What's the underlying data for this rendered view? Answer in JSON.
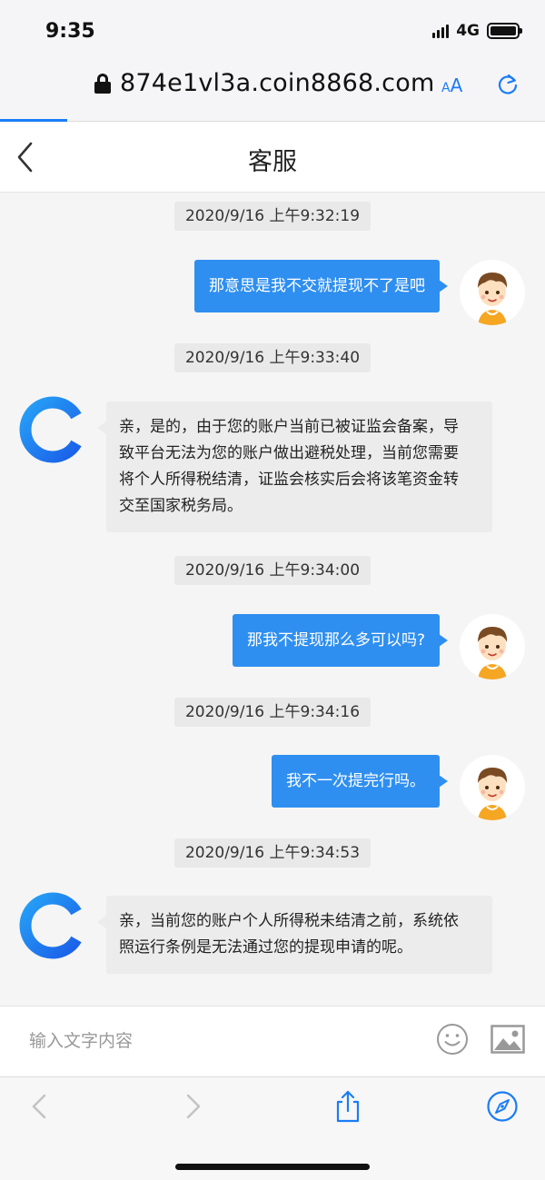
{
  "status_bar": {
    "time": "9:35",
    "network": "4G"
  },
  "browser": {
    "url": "874e1vl3a.coin8868.com",
    "text_size_label_big": "A",
    "text_size_label_small": "A",
    "accent_color": "#1a7cf5"
  },
  "header": {
    "title": "客服"
  },
  "messages": [
    {
      "type": "timestamp",
      "text": "2020/9/16 上午9:32:19"
    },
    {
      "type": "outgoing",
      "text": "那意思是我不交就提现不了是吧"
    },
    {
      "type": "timestamp",
      "text": "2020/9/16 上午9:33:40"
    },
    {
      "type": "incoming",
      "lines": [
        "亲，是的，由于您的账户当前已被证监会备案，导",
        "致平台无法为您的账户做出避税处理，当前您需要",
        "将个人所得税结清，证监会核实后会将该笔资金转",
        "交至国家税务局。"
      ]
    },
    {
      "type": "timestamp",
      "text": "2020/9/16 上午9:34:00"
    },
    {
      "type": "outgoing",
      "text": "那我不提现那么多可以吗?"
    },
    {
      "type": "timestamp",
      "text": "2020/9/16 上午9:34:16"
    },
    {
      "type": "outgoing",
      "text": "我不一次提完行吗。"
    },
    {
      "type": "timestamp",
      "text": "2020/9/16 上午9:34:53"
    },
    {
      "type": "incoming",
      "lines": [
        "亲，当前您的账户个人所得税未结清之前，系统依",
        "照运行条例是无法通过您的提现申请的呢。"
      ]
    }
  ],
  "input": {
    "placeholder": "输入文字内容",
    "value": ""
  },
  "colors": {
    "outgoing_bubble": "#2f8ff0",
    "incoming_bubble": "#ececec",
    "agent_logo_blue": "#1b6ff2"
  },
  "icons": {
    "emoji": "smiley-icon",
    "image": "image-icon",
    "share": "share-icon",
    "compass": "compass-icon"
  }
}
